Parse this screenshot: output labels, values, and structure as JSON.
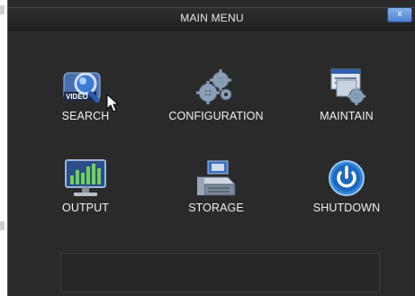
{
  "window": {
    "title": "MAIN MENU",
    "close_label": "x"
  },
  "menu": [
    {
      "id": "search",
      "label": "SEARCH",
      "icon": "video-search-icon"
    },
    {
      "id": "configuration",
      "label": "CONFIGURATION",
      "icon": "gears-icon"
    },
    {
      "id": "maintain",
      "label": "MAINTAIN",
      "icon": "maintain-icon"
    },
    {
      "id": "output",
      "label": "OUTPUT",
      "icon": "monitor-icon"
    },
    {
      "id": "storage",
      "label": "STORAGE",
      "icon": "hard-drive-icon"
    },
    {
      "id": "shutdown",
      "label": "SHUTDOWN",
      "icon": "power-icon"
    }
  ],
  "colors": {
    "background": "#2a2a2a",
    "text": "#f0f0f0",
    "accent": "#2f86d8"
  }
}
